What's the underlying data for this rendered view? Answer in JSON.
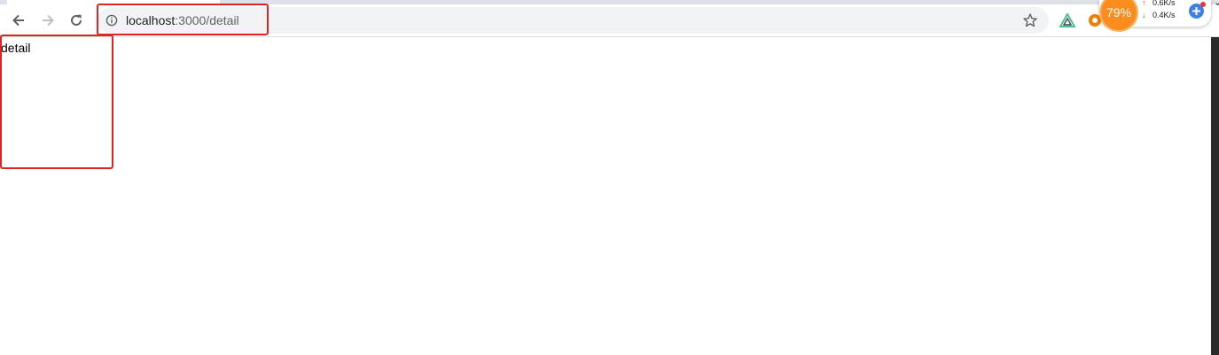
{
  "browser": {
    "address_bar": {
      "host": "localhost",
      "path": ":3000/detail"
    }
  },
  "page": {
    "text": "detail"
  },
  "network_widget": {
    "percent": "79%",
    "upload": "0.6K/s",
    "download": "0.4K/s",
    "upload_color": "#e53935",
    "download_color": "#2e7d32"
  },
  "colors": {
    "highlight": "#e02424",
    "omnibox_bg": "#f1f3f4",
    "gauge": "#fb8c1e",
    "boost_button": "#3d80e8"
  },
  "icons": {
    "back": "arrow-left-icon",
    "forward": "arrow-right-icon",
    "reload": "reload-icon",
    "site_info": "info-circle-icon",
    "bookmark": "star-icon",
    "extension_1": "vue-devtools-triangle-icon",
    "extension_2": "orange-extension-icon",
    "boost": "plus-icon"
  }
}
